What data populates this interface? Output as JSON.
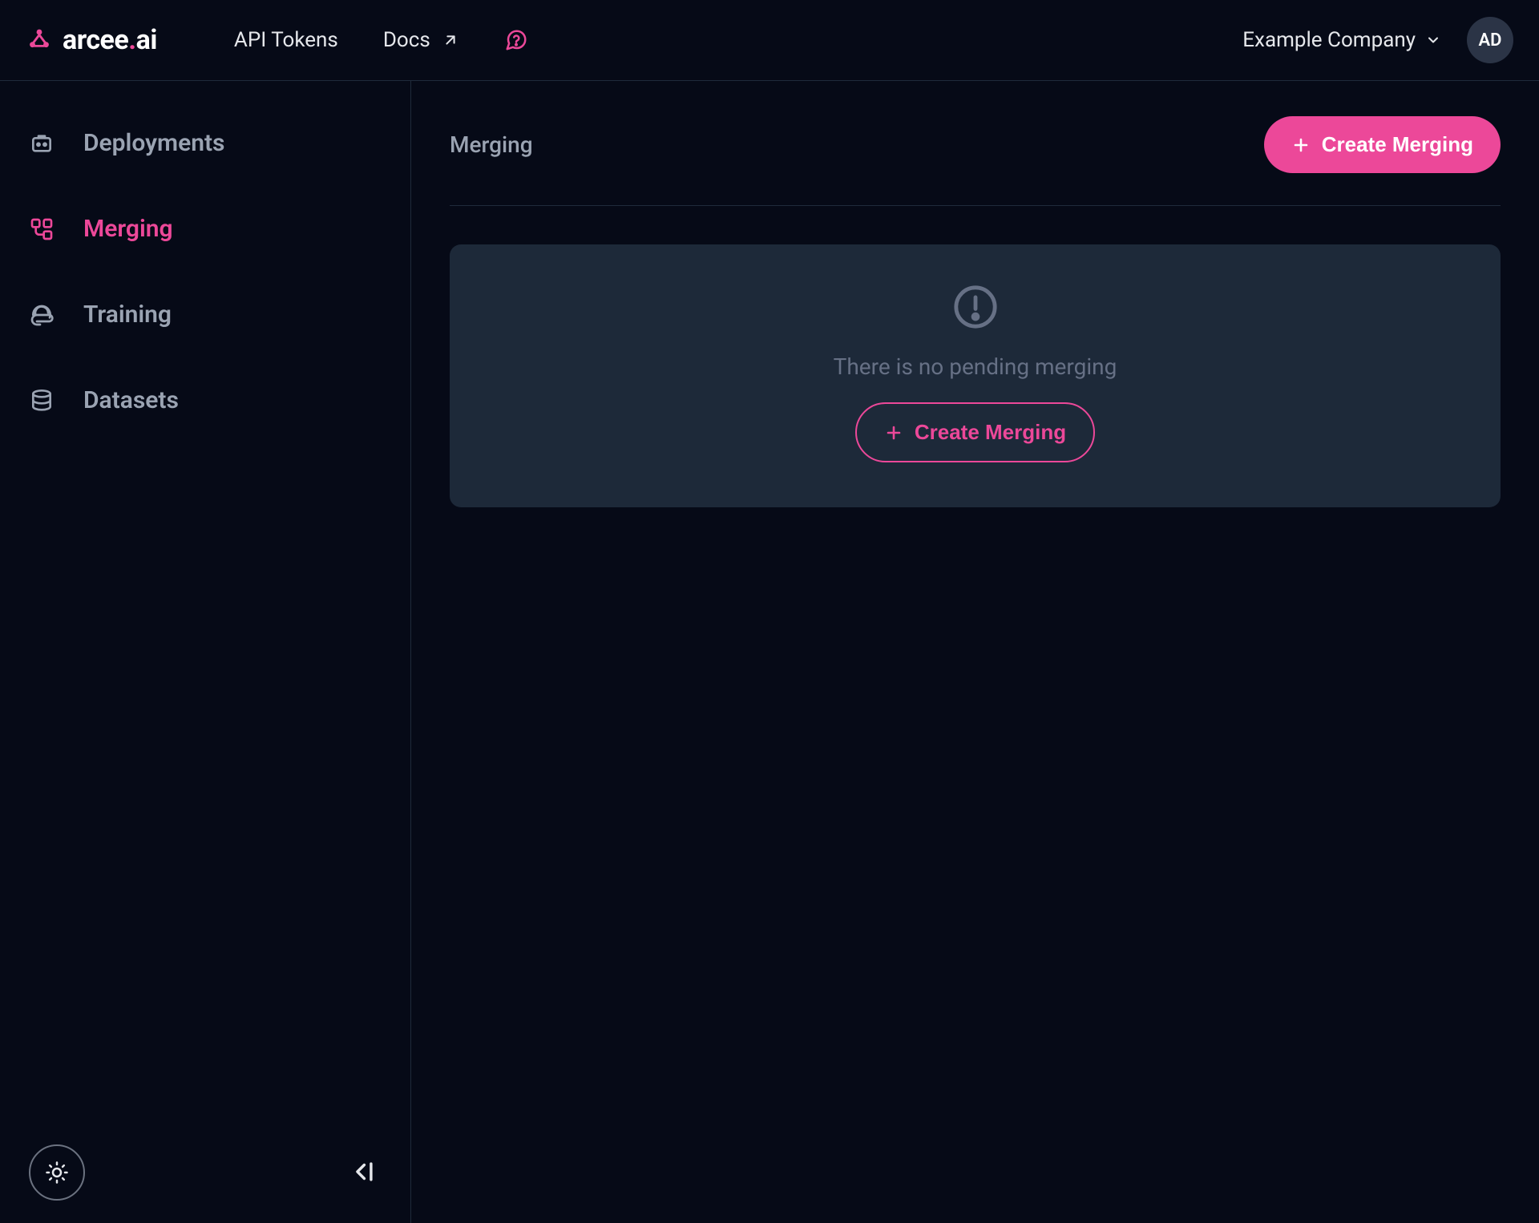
{
  "brand": {
    "name": "arcee.ai"
  },
  "header": {
    "api_tokens": "API Tokens",
    "docs": "Docs",
    "org_name": "Example Company",
    "avatar_initials": "AD"
  },
  "sidebar": {
    "items": [
      {
        "label": "Deployments"
      },
      {
        "label": "Merging"
      },
      {
        "label": "Training"
      },
      {
        "label": "Datasets"
      }
    ]
  },
  "page": {
    "title": "Merging",
    "create_label": "Create Merging",
    "empty_message": "There is no pending merging",
    "empty_cta": "Create Merging"
  }
}
